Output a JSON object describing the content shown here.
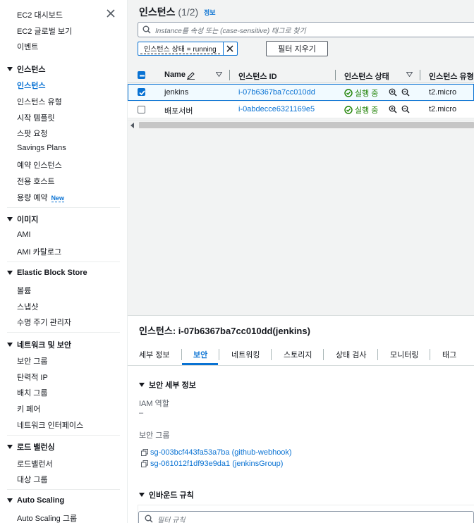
{
  "sidebar": {
    "top_links": [
      "EC2 대시보드",
      "EC2 글로벌 보기",
      "이벤트"
    ],
    "sections": [
      {
        "title": "인스턴스",
        "items": [
          "인스턴스",
          "인스턴스 유형",
          "시작 템플릿",
          "스팟 요청",
          "Savings Plans",
          "예약 인스턴스",
          "전용 호스트",
          "용량 예약"
        ],
        "active": "인스턴스",
        "new_badge_item": "용량 예약"
      },
      {
        "title": "이미지",
        "items": [
          "AMI",
          "AMI 카탈로그"
        ]
      },
      {
        "title": "Elastic Block Store",
        "items": [
          "볼륨",
          "스냅샷",
          "수명 주기 관리자"
        ]
      },
      {
        "title": "네트워크 및 보안",
        "items": [
          "보안 그룹",
          "탄력적 IP",
          "배치 그룹",
          "키 페어",
          "네트워크 인터페이스"
        ]
      },
      {
        "title": "로드 밸런싱",
        "items": [
          "로드밸런서",
          "대상 그룹"
        ]
      },
      {
        "title": "Auto Scaling",
        "items": [
          "Auto Scaling 그룹"
        ]
      }
    ],
    "new_badge": "New",
    "close_icon": "close-icon"
  },
  "header": {
    "title": "인스턴스",
    "count": "(1/2)",
    "info_link": "정보"
  },
  "search": {
    "placeholder": "Instance를 속성 또는 (case-sensitive) 태그로 찾기"
  },
  "filter": {
    "chip_label": "인스턴스 상태 = running",
    "clear_button": "필터 지우기"
  },
  "table": {
    "columns": [
      "Name",
      "인스턴스 ID",
      "인스턴스 상태",
      "인스턴스 유형"
    ],
    "rows": [
      {
        "name": "jenkins",
        "id": "i-07b6367ba7cc010dd",
        "state": "실행 중",
        "type": "t2.micro",
        "selected": true
      },
      {
        "name": "배포서버",
        "id": "i-0abdecce6321169e5",
        "state": "실행 중",
        "type": "t2.micro",
        "selected": false
      }
    ]
  },
  "detail": {
    "title": "인스턴스: i-07b6367ba7cc010dd(jenkins)",
    "tabs": [
      "세부 정보",
      "보안",
      "네트워킹",
      "스토리지",
      "상태 검사",
      "모니터링",
      "태그"
    ],
    "active_tab": "보안",
    "security_section_title": "보안 세부 정보",
    "iam_label": "IAM 역할",
    "iam_value": "–",
    "sg_label": "보안 그룹",
    "security_groups": [
      "sg-003bcf443fa53a7ba (github-webhook)",
      "sg-061012f1df93e9da1 (jenkinsGroup)"
    ],
    "inbound_title": "인바운드 규칙",
    "inbound_search_placeholder": "필터 규칙"
  },
  "colors": {
    "accent": "#0972d3",
    "running_green": "#1d8102",
    "panel_bg": "#f2f3f3"
  }
}
